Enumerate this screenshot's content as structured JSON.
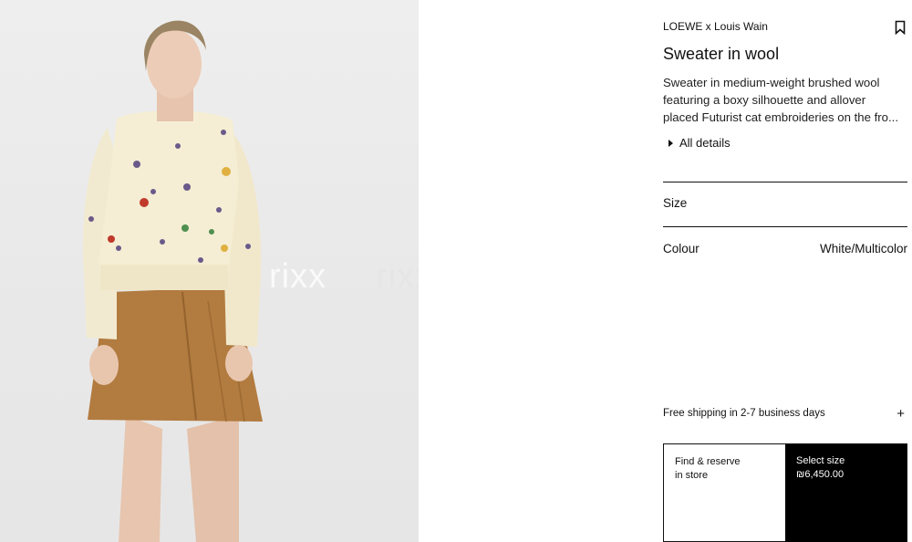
{
  "product": {
    "brand": "LOEWE x Louis Wain",
    "title": "Sweater in wool",
    "description_lines": [
      "Sweater in medium-weight brushed wool",
      "featuring a boxy silhouette and allover",
      "placed Futurist cat embroideries on the fro..."
    ],
    "all_details_label": "All details",
    "bookmark_icon": "bookmark-icon"
  },
  "selectors": {
    "size_label": "Size",
    "colour_label": "Colour",
    "colour_value": "White/Multicolor"
  },
  "shipping": {
    "label": "Free shipping in 2-7 business days",
    "icon": "plus-icon"
  },
  "actions": {
    "find_line1": "Find & reserve",
    "find_line2": "in store",
    "select_label": "Select size",
    "price": "₪6,450.00"
  },
  "image": {
    "watermark_left": "rixx",
    "watermark_right": "rixx",
    "colors": {
      "sweater": "#f3eccf",
      "skirt": "#b07a3e",
      "hair": "#9a8463",
      "skin": "#e9c9b2"
    }
  }
}
